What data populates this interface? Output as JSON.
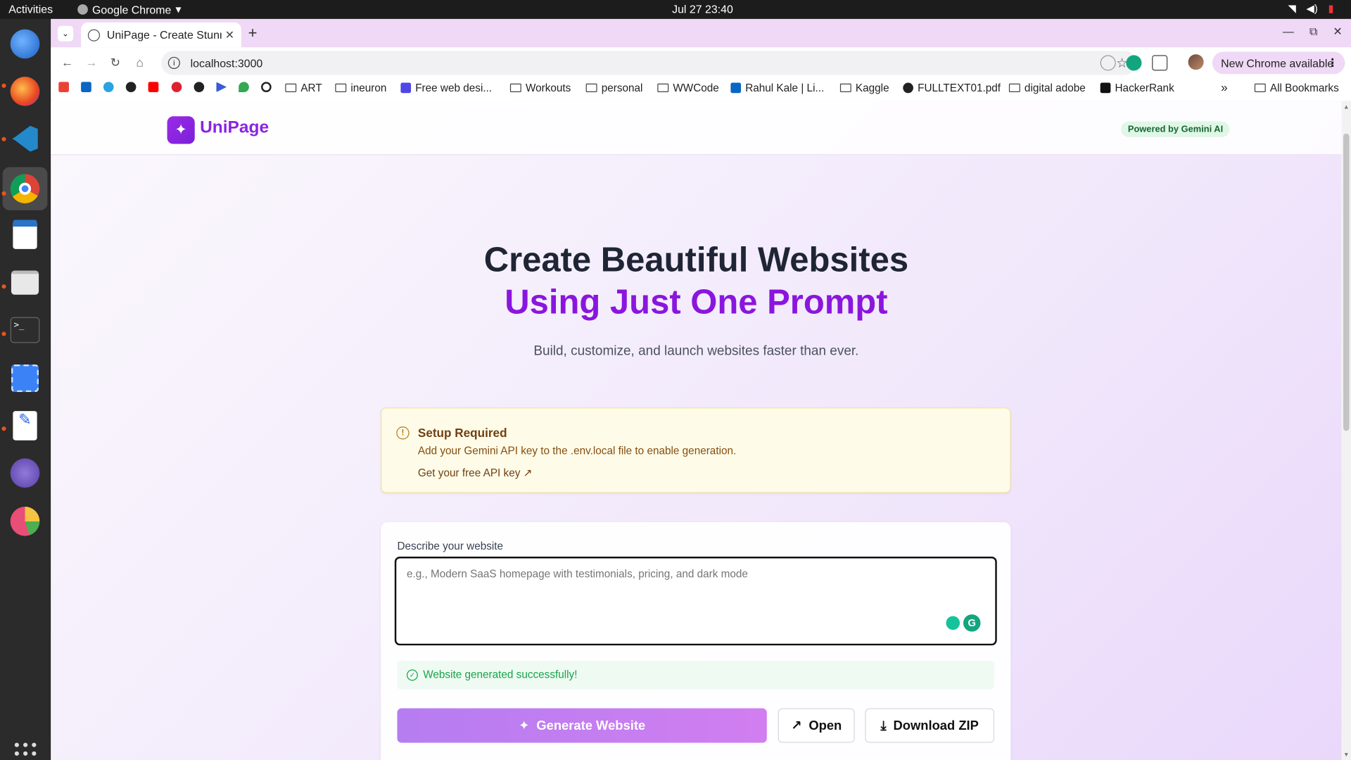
{
  "system": {
    "activities": "Activities",
    "app_name": "Google Chrome",
    "clock": "Jul 27  23:40"
  },
  "dock": {
    "apps": [
      "thunderbird",
      "firefox",
      "vscode",
      "chrome",
      "writer",
      "files",
      "terminal",
      "screenshot",
      "text-editor",
      "network-app",
      "pie-app"
    ]
  },
  "browser": {
    "tab_title": "UniPage - Create Stunning",
    "url": "localhost:3000",
    "new_chrome": "New Chrome available",
    "bookmarks": [
      {
        "label": "",
        "icon": "gmail-icon"
      },
      {
        "label": "",
        "icon": "linkedin-icon"
      },
      {
        "label": "",
        "icon": "telegram-icon"
      },
      {
        "label": "",
        "icon": "globe-icon"
      },
      {
        "label": "",
        "icon": "youtube-icon"
      },
      {
        "label": "",
        "icon": "music-icon"
      },
      {
        "label": "",
        "icon": "globe-icon"
      },
      {
        "label": "",
        "icon": "play-icon"
      },
      {
        "label": "",
        "icon": "maps-icon"
      },
      {
        "label": "",
        "icon": "github-icon"
      },
      {
        "label": "ART",
        "icon": "folder-icon"
      },
      {
        "label": "ineuron",
        "icon": "folder-icon"
      },
      {
        "label": "Free web desi...",
        "icon": "site-icon"
      },
      {
        "label": "Workouts",
        "icon": "folder-icon"
      },
      {
        "label": "personal",
        "icon": "folder-icon"
      },
      {
        "label": "WWCode",
        "icon": "folder-icon"
      },
      {
        "label": "Rahul Kale | Li...",
        "icon": "linkedin-icon"
      },
      {
        "label": "Kaggle",
        "icon": "folder-icon"
      },
      {
        "label": "FULLTEXT01.pdf",
        "icon": "globe-icon"
      },
      {
        "label": "digital adobe",
        "icon": "folder-icon"
      },
      {
        "label": "HackerRank",
        "icon": "hackerrank-icon"
      }
    ],
    "more_bookmarks": "»",
    "all_bookmarks": "All Bookmarks"
  },
  "site": {
    "brand": "UniPage",
    "badge": "Powered by Gemini AI",
    "hero_line1": "Create Beautiful Websites",
    "hero_line2": "Using Just One Prompt",
    "subtitle": "Build, customize, and launch websites faster than ever.",
    "alert": {
      "title": "Setup Required",
      "message": "Add your Gemini API key to the .env.local file to enable generation.",
      "link": "Get your free API key ↗"
    },
    "form": {
      "label": "Describe your website",
      "placeholder": "e.g., Modern SaaS homepage with testimonials, pricing, and dark mode",
      "value": "",
      "success": "Website generated successfully!",
      "generate": "Generate Website",
      "open": "Open",
      "download": "Download ZIP"
    }
  },
  "colors": {
    "brand": "#8a24e0",
    "accent_purple": "#8a16de",
    "success_green": "#16a34a",
    "warning_bg": "#fefce8"
  }
}
